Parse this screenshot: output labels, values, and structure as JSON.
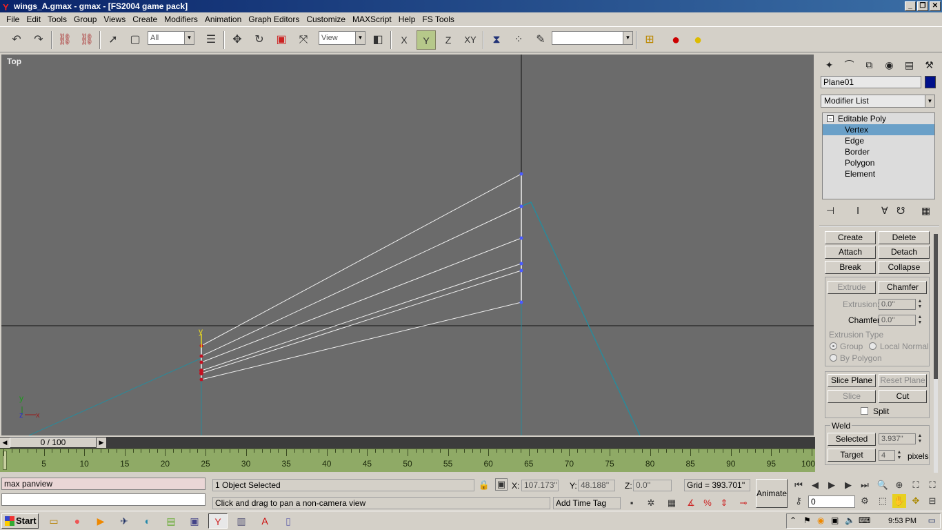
{
  "window": {
    "title": "wings_A.gmax - gmax - [FS2004 game pack]",
    "controls": [
      "_",
      "❐",
      "✕"
    ]
  },
  "menu": [
    "File",
    "Edit",
    "Tools",
    "Group",
    "Views",
    "Create",
    "Modifiers",
    "Animation",
    "Graph Editors",
    "Customize",
    "MAXScript",
    "Help",
    "FS Tools"
  ],
  "toolbar": {
    "selection_filter": "All",
    "reference_coord": "View",
    "axis_x": "X",
    "axis_y": "Y",
    "axis_z": "Z",
    "axis_xy": "XY",
    "named_selection": ""
  },
  "viewport": {
    "label": "Top",
    "gizmo_y": "y",
    "axis_y": "y",
    "axis_z": "z",
    "axis_x": "x"
  },
  "command_panel": {
    "object_name": "Plane01",
    "object_color": "#00108a",
    "modifier_list": "Modifier List",
    "stack": [
      {
        "label": "Editable Poly",
        "level": "top",
        "selected": false
      },
      {
        "label": "Vertex",
        "level": "sub",
        "selected": true
      },
      {
        "label": "Edge",
        "level": "sub",
        "selected": false
      },
      {
        "label": "Border",
        "level": "sub",
        "selected": false
      },
      {
        "label": "Polygon",
        "level": "sub",
        "selected": false
      },
      {
        "label": "Element",
        "level": "sub",
        "selected": false
      }
    ],
    "buttons": {
      "create": "Create",
      "delete": "Delete",
      "attach": "Attach",
      "detach": "Detach",
      "break": "Break",
      "collapse": "Collapse",
      "extrude": "Extrude",
      "chamfer": "Chamfer",
      "slice_plane": "Slice Plane",
      "reset_plane": "Reset Plane",
      "slice": "Slice",
      "cut": "Cut",
      "selected": "Selected",
      "target": "Target"
    },
    "extrusion_label": "Extrusion:",
    "extrusion_value": "0.0''",
    "chamfer_label": "Chamfer",
    "chamfer_value": "0.0''",
    "extrusion_type_label": "Extrusion Type",
    "radio_group": "Group",
    "radio_local_normal": "Local Normal",
    "radio_by_polygon": "By Polygon",
    "split_label": "Split",
    "weld_label": "Weld",
    "weld_selected_value": "3.937''",
    "weld_target_value": "4",
    "pixels_label": "pixels"
  },
  "timeline": {
    "frame": "0 / 100",
    "current": 0,
    "total": 100,
    "ticks": [
      "5",
      "10",
      "15",
      "20",
      "25",
      "30",
      "35",
      "40",
      "45",
      "50",
      "55",
      "60",
      "65",
      "70",
      "75",
      "80",
      "85",
      "90",
      "95",
      "100"
    ]
  },
  "status": {
    "script_input": "max panview",
    "script_output": "",
    "selection": "1 Object Selected",
    "prompt": "Click and drag to pan a non-camera view",
    "x_label": "X:",
    "x_value": "107.173''",
    "y_label": "Y:",
    "y_value": "48.188''",
    "z_label": "Z:",
    "z_value": "0.0''",
    "grid": "Grid = 393.701''",
    "add_time_tag": "Add Time Tag",
    "animate": "Animate",
    "frame_field": "0"
  },
  "taskbar": {
    "start": "Start",
    "clock": "9:53 PM"
  }
}
